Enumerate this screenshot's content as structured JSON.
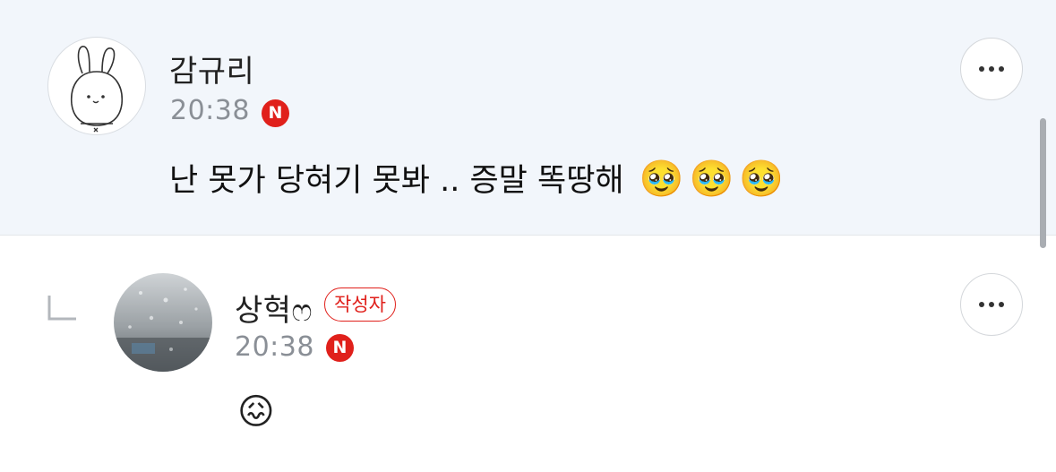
{
  "comments": [
    {
      "author": "감규리",
      "time": "20:38",
      "badge": "N",
      "text": "난 못가 당혀기 못봐 .. 증말 똑땅해",
      "emojis": [
        "🥹",
        "🥹",
        "🥹"
      ],
      "avatar_icon": "bunny-avatar-icon",
      "more_icon": "more-dots-icon"
    },
    {
      "author": "상혁ෆ",
      "author_tag": "작성자",
      "time": "20:38",
      "badge": "N",
      "emoji": "😖",
      "avatar_icon": "rain-window-avatar",
      "reply_icon": "reply-arrow-icon",
      "more_icon": "more-dots-icon"
    }
  ],
  "colors": {
    "highlight_bg": "#f2f6fb",
    "badge_red": "#e0201b",
    "time_gray": "#8a8f96"
  }
}
